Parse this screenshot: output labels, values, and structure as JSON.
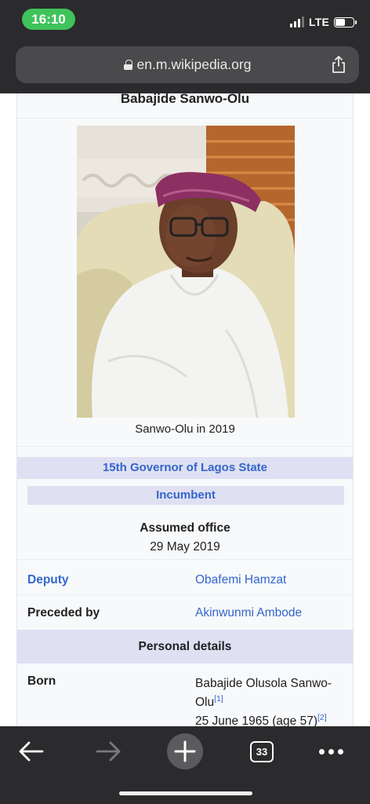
{
  "status_bar": {
    "time": "16:10",
    "network": "LTE",
    "battery_level": 0.55
  },
  "browser": {
    "url": "en.m.wikipedia.org"
  },
  "infobox": {
    "title": "Babajide Sanwo-Olu",
    "caption": "Sanwo-Olu in 2019",
    "office": "15th Governor of Lagos State",
    "status": "Incumbent",
    "assumed_office_label": "Assumed office",
    "assumed_office_date": "29 May 2019",
    "deputy_label": "Deputy",
    "deputy_value": "Obafemi Hamzat",
    "preceded_by_label": "Preceded by",
    "preceded_by_value": "Akinwunmi Ambode",
    "personal_details_label": "Personal details",
    "born_label": "Born",
    "born_name": "Babajide Olusola Sanwo-Olu",
    "born_name_ref": "[1]",
    "born_date": "25 June 1965 (age 57)",
    "born_date_ref": "[2]"
  },
  "toolbar": {
    "tab_count": "33"
  },
  "icons": {
    "lock": "lock-icon",
    "share": "share-icon",
    "back": "back-arrow-icon",
    "forward": "forward-arrow-icon",
    "new_tab": "plus-icon",
    "tabs": "tabs-icon",
    "more": "more-icon"
  },
  "colors": {
    "link": "#3366cc",
    "band": "#dfe0f2",
    "chrome": "#2b2b2d",
    "time_pill": "#3fc35b"
  }
}
